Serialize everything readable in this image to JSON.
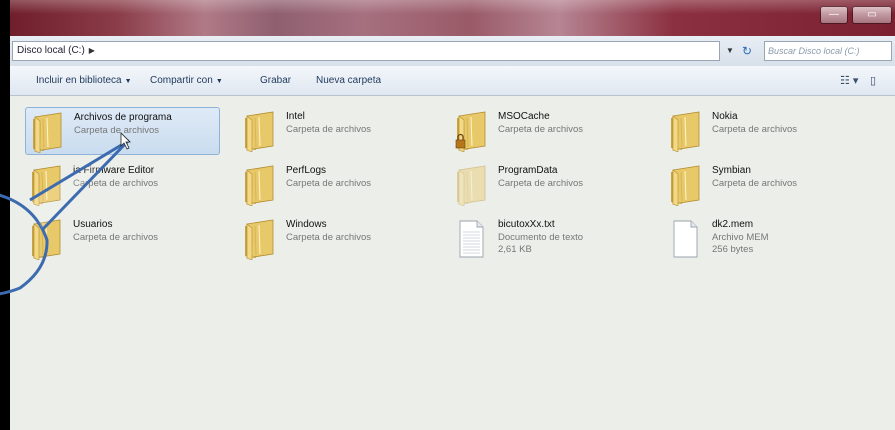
{
  "window": {
    "title_controls": {
      "minimize": "—",
      "maximize": "▭"
    }
  },
  "address": {
    "breadcrumb": "Disco local (C:)",
    "search_placeholder": "Buscar Disco local (C:)"
  },
  "toolbar": {
    "include_library": "Incluir en biblioteca",
    "share_with": "Compartir con",
    "burn": "Grabar",
    "new_folder": "Nueva carpeta"
  },
  "items": [
    {
      "name": "Archivos de programa",
      "type": "Carpeta de archivos",
      "kind": "folder",
      "selected": true
    },
    {
      "name": "Intel",
      "type": "Carpeta de archivos",
      "kind": "folder"
    },
    {
      "name": "MSOCache",
      "type": "Carpeta de archivos",
      "kind": "folder-locked"
    },
    {
      "name": "Nokia",
      "type": "Carpeta de archivos",
      "kind": "folder"
    },
    {
      "name": "ia Firmware Editor",
      "type": "Carpeta de archivos",
      "kind": "folder"
    },
    {
      "name": "PerfLogs",
      "type": "Carpeta de archivos",
      "kind": "folder"
    },
    {
      "name": "ProgramData",
      "type": "Carpeta de archivos",
      "kind": "folder-hidden"
    },
    {
      "name": "Symbian",
      "type": "Carpeta de archivos",
      "kind": "folder"
    },
    {
      "name": "Usuarios",
      "type": "Carpeta de archivos",
      "kind": "folder"
    },
    {
      "name": "Windows",
      "type": "Carpeta de archivos",
      "kind": "folder"
    },
    {
      "name": "bicutoxXx.txt",
      "type": "Documento de texto",
      "size": "2,61 KB",
      "kind": "text-file"
    },
    {
      "name": "dk2.mem",
      "type": "Archivo MEM",
      "size": "256 bytes",
      "kind": "file"
    }
  ],
  "colors": {
    "titlebar": "#8a3c48",
    "selection": "#c9dcef",
    "callout_stroke": "#3d6bb0"
  }
}
